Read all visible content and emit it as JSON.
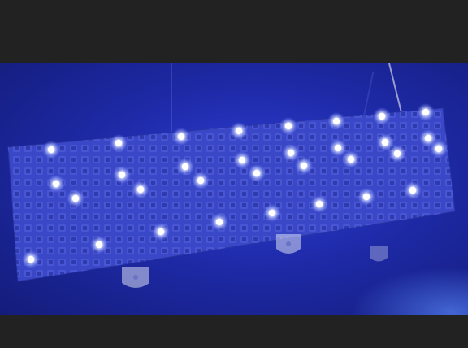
{
  "scene": {
    "subject": "led-matrix-panel",
    "background_color": "#222222",
    "wall_color": "#2331b8",
    "panel_color": "#3543c0",
    "led_color": "#ffffff",
    "led_glow_color": "#9aa8ff"
  }
}
